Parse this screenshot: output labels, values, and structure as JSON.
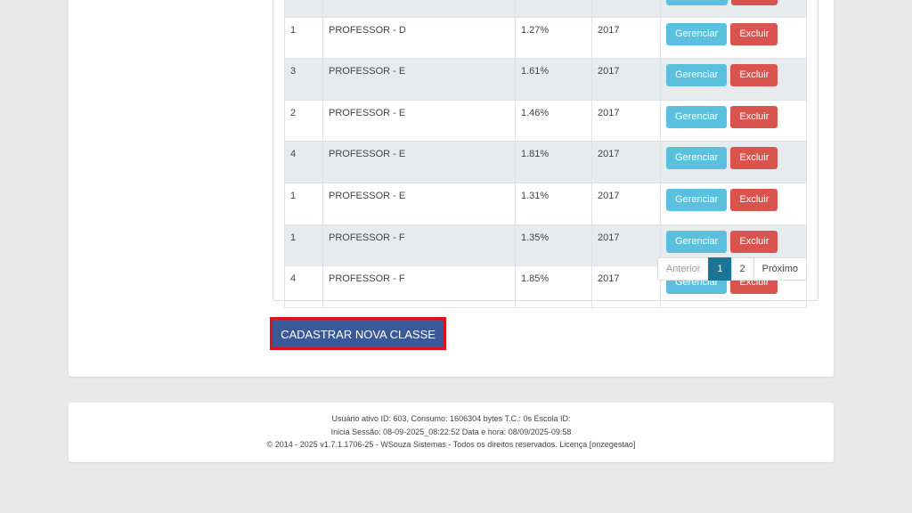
{
  "table": {
    "rows": [
      {
        "num": "1",
        "classe": "PROFESSOR - D",
        "pct": "1.27%",
        "ano": "2017"
      },
      {
        "num": "3",
        "classe": "PROFESSOR - E",
        "pct": "1.61%",
        "ano": "2017"
      },
      {
        "num": "2",
        "classe": "PROFESSOR - E",
        "pct": "1.46%",
        "ano": "2017"
      },
      {
        "num": "4",
        "classe": "PROFESSOR - E",
        "pct": "1.81%",
        "ano": "2017"
      },
      {
        "num": "1",
        "classe": "PROFESSOR - E",
        "pct": "1.31%",
        "ano": "2017"
      },
      {
        "num": "1",
        "classe": "PROFESSOR - F",
        "pct": "1.35%",
        "ano": "2017"
      },
      {
        "num": "4",
        "classe": "PROFESSOR - F",
        "pct": "1.85%",
        "ano": "2017"
      }
    ],
    "manage_label": "Gerenciar",
    "delete_label": "Excluir"
  },
  "pagination": {
    "prev": "Anterior",
    "page1": "1",
    "page2": "2",
    "next": "Próximo"
  },
  "register_button": "CADASTRAR NOVA CLASSE",
  "footer": {
    "line1": "Usuário ativo ID: 603, Consumo: 1606304 bytes T.C.: 0s Escola ID:",
    "line2": "Inicia Sessão: 08-09-2025_08:22:52 Data e hora: 08/09/2025-09:58",
    "line3": "© 2014 - 2025 v1.7.1.1706-25 - WSouza Sistemas - Todos os direitos reservados. Licença [onzegestao]"
  },
  "colors": {
    "manage": "#5bc0de",
    "delete": "#d9534f",
    "active_page": "#1b7595",
    "register": "#3b5998",
    "highlight": "#e0101a"
  }
}
